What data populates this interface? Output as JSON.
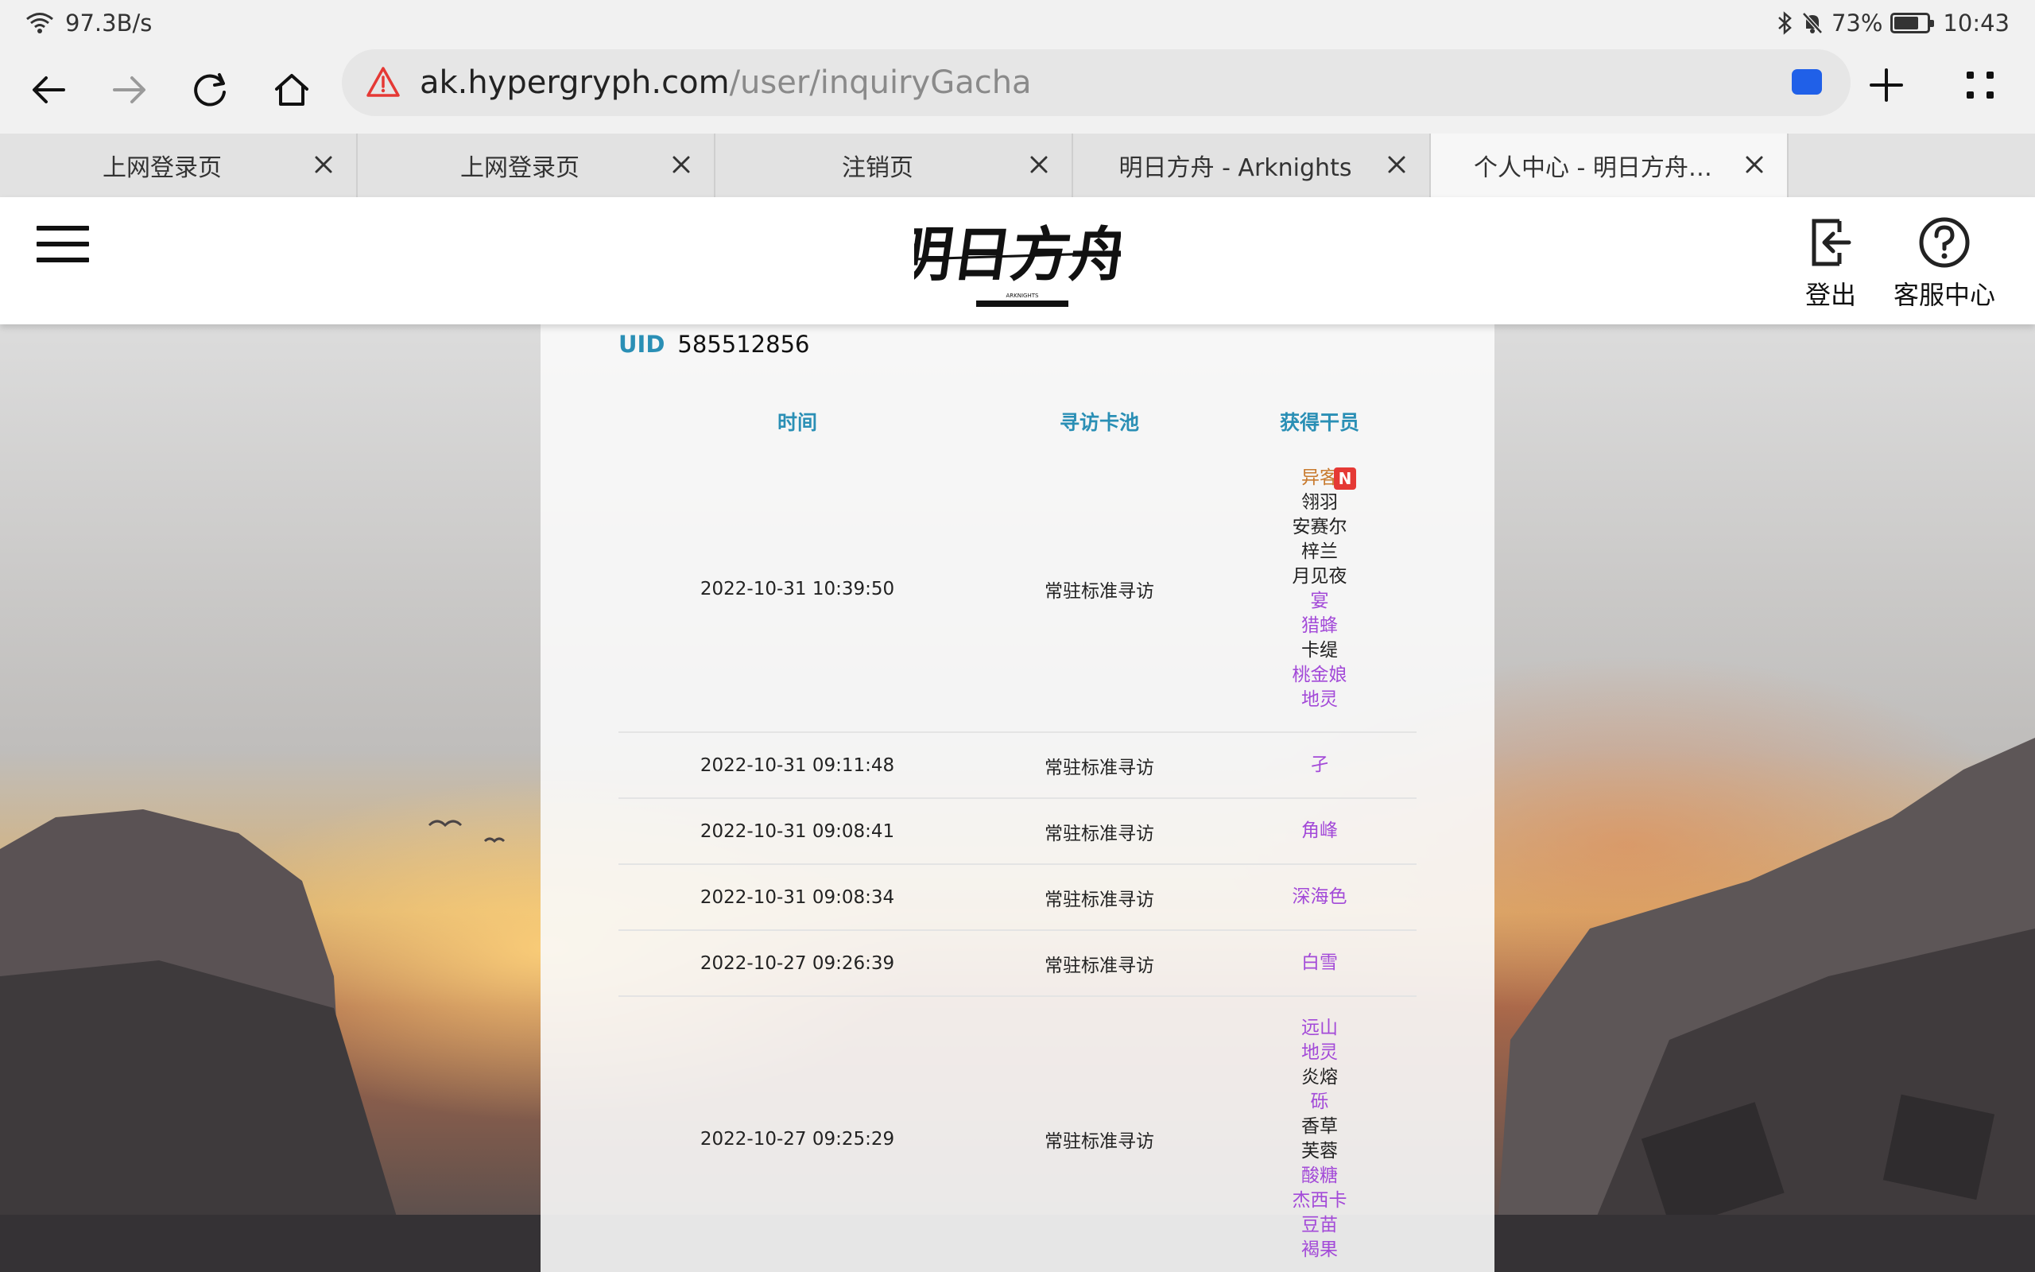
{
  "statusbar": {
    "speed": "97.3B/s",
    "battery": "73%",
    "battery_level": 0.73,
    "time": "10:43"
  },
  "browser": {
    "url_host": "ak.hypergryph.com",
    "url_path": "/user/inquiryGacha",
    "tabs": [
      {
        "title": "上网登录页"
      },
      {
        "title": "上网登录页"
      },
      {
        "title": "注销页"
      },
      {
        "title": "明日方舟 - Arknights"
      },
      {
        "title": "个人中心 - 明日方舟 - Arknights"
      }
    ]
  },
  "header": {
    "logout": "登出",
    "service": "客服中心",
    "logo_text": "明日方舟",
    "logo_sub": "ARKNIGHTS"
  },
  "uid": {
    "label": "UID",
    "value": "585512856"
  },
  "table": {
    "headers": [
      "时间",
      "寻访卡池",
      "获得干员"
    ],
    "rows": [
      {
        "time": "2022-10-31 10:39:50",
        "pool": "常驻标准寻访",
        "ops": [
          {
            "name": "异客",
            "rarity": 5,
            "new": "N"
          },
          {
            "name": "翎羽",
            "rarity": 3
          },
          {
            "name": "安赛尔",
            "rarity": 3
          },
          {
            "name": "梓兰",
            "rarity": 3
          },
          {
            "name": "月见夜",
            "rarity": 3
          },
          {
            "name": "宴",
            "rarity": 4
          },
          {
            "name": "猎蜂",
            "rarity": 4
          },
          {
            "name": "卡缇",
            "rarity": 3
          },
          {
            "name": "桃金娘",
            "rarity": 4
          },
          {
            "name": "地灵",
            "rarity": 4
          }
        ]
      },
      {
        "time": "2022-10-31 09:11:48",
        "pool": "常驻标准寻访",
        "ops": [
          {
            "name": "孑",
            "rarity": 4
          }
        ]
      },
      {
        "time": "2022-10-31 09:08:41",
        "pool": "常驻标准寻访",
        "ops": [
          {
            "name": "角峰",
            "rarity": 4
          }
        ]
      },
      {
        "time": "2022-10-31 09:08:34",
        "pool": "常驻标准寻访",
        "ops": [
          {
            "name": "深海色",
            "rarity": 4
          }
        ]
      },
      {
        "time": "2022-10-27 09:26:39",
        "pool": "常驻标准寻访",
        "ops": [
          {
            "name": "白雪",
            "rarity": 4
          }
        ]
      },
      {
        "time": "2022-10-27 09:25:29",
        "pool": "常驻标准寻访",
        "ops": [
          {
            "name": "远山",
            "rarity": 4
          },
          {
            "name": "地灵",
            "rarity": 4
          },
          {
            "name": "炎熔",
            "rarity": 3
          },
          {
            "name": "砾",
            "rarity": 4
          },
          {
            "name": "香草",
            "rarity": 3
          },
          {
            "name": "芙蓉",
            "rarity": 3
          },
          {
            "name": "酸糖",
            "rarity": 4
          },
          {
            "name": "杰西卡",
            "rarity": 4
          },
          {
            "name": "豆苗",
            "rarity": 4
          },
          {
            "name": "褐果",
            "rarity": 4
          }
        ]
      }
    ]
  },
  "colors": {
    "accent": "#2a8fb5",
    "rarity4": "#a34ad8",
    "rarity5": "#c87a2e",
    "new_tag": "#e53935"
  }
}
